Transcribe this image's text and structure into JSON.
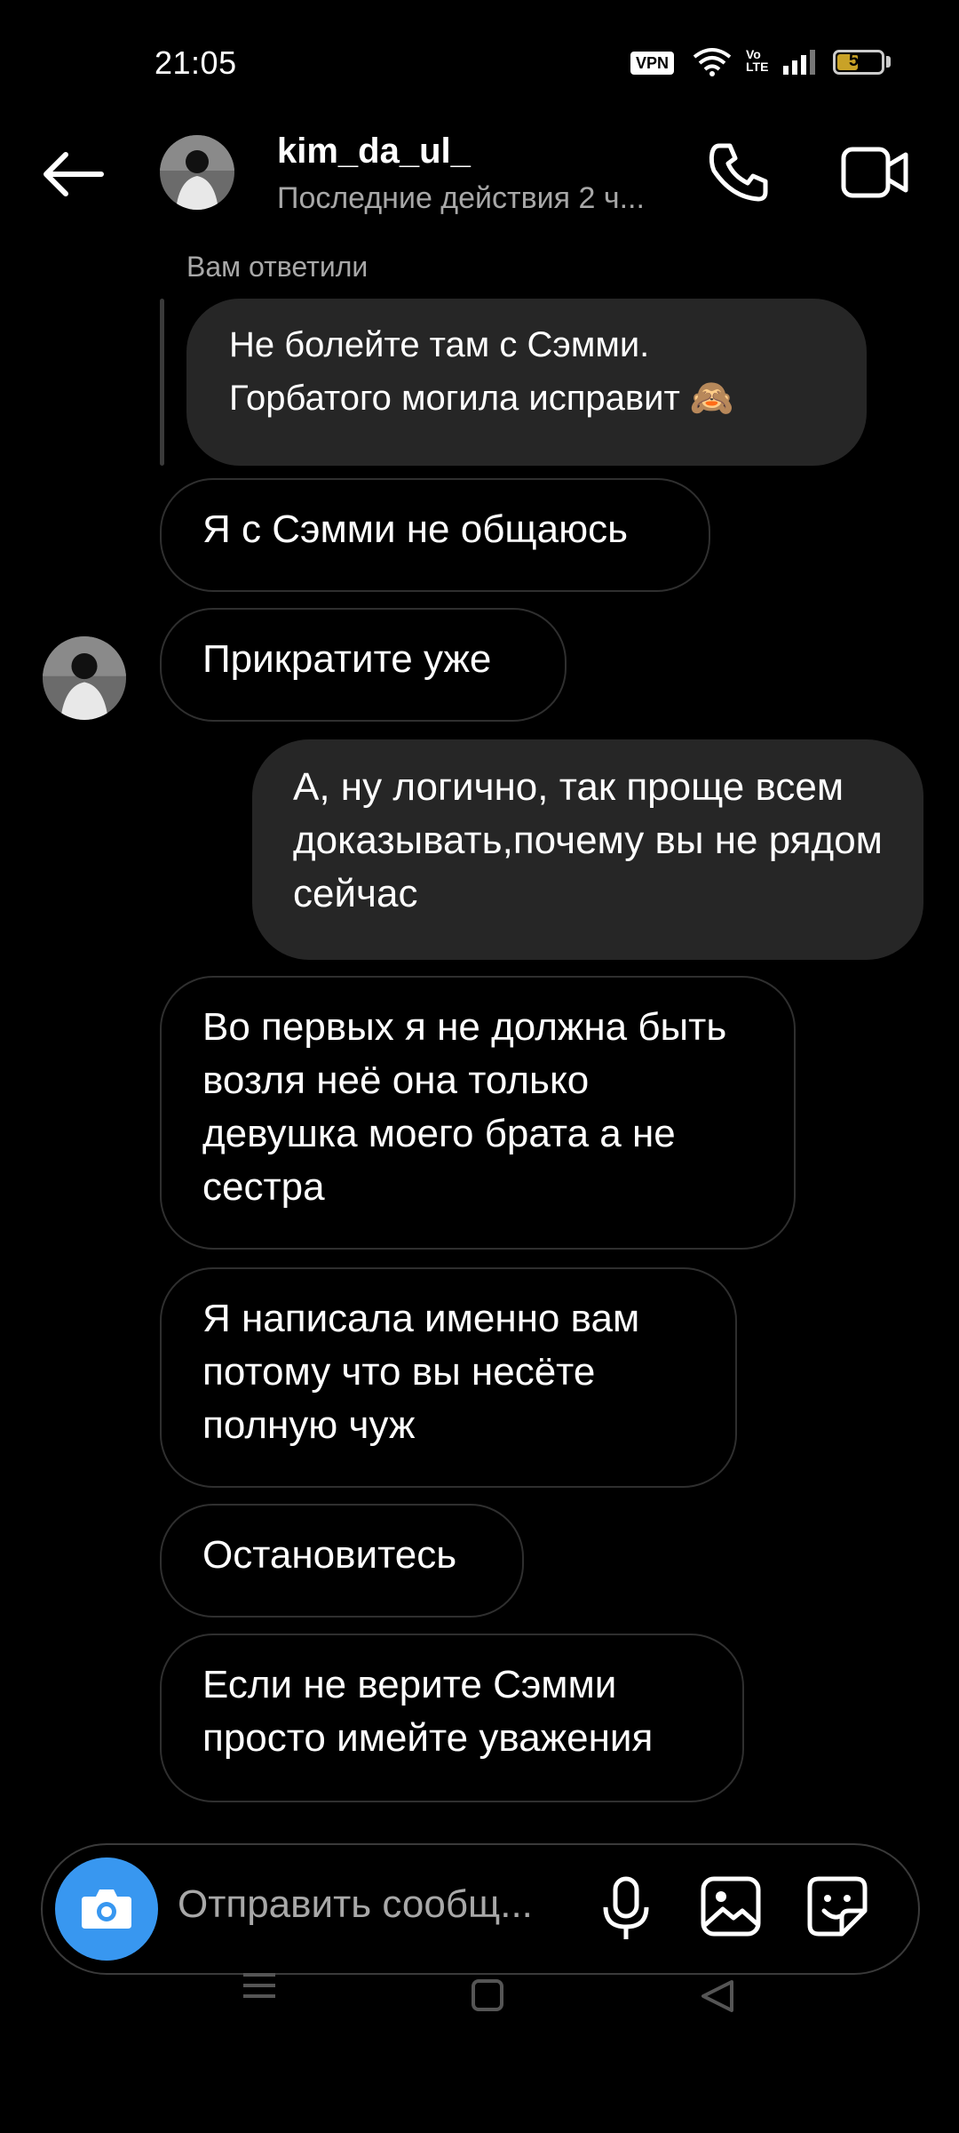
{
  "status_bar": {
    "time": "21:05",
    "vpn": "VPN",
    "volte": "Vo LTE",
    "battery": "52",
    "battery_level": 0.52
  },
  "header": {
    "username": "kim_da_ul_",
    "last_active": "Последние действия 2 ч..."
  },
  "chat": {
    "reply_label": "Вам ответили",
    "quoted_message_line1": "Не болейте там с Сэмми.",
    "quoted_message_line2": "Горбатого могила исправит 🙈",
    "messages": [
      {
        "direction": "in",
        "text": "Я с Сэмми не общаюсь"
      },
      {
        "direction": "in",
        "text": "Прикратите уже"
      },
      {
        "direction": "out",
        "text": "А, ну логично, так проще всем доказывать,почему вы не рядом сейчас"
      },
      {
        "direction": "in",
        "text": "Во первых я не должна быть возля неё она только девушка моего брата а не сестра"
      },
      {
        "direction": "in",
        "text": "Я написала именно вам потому что вы несёте полную чуж"
      },
      {
        "direction": "in",
        "text": "Остановитесь"
      },
      {
        "direction": "in",
        "text": "Если не верите Сэмми просто имейте уважения"
      }
    ]
  },
  "composer": {
    "placeholder": "Отправить сообщ..."
  },
  "colors": {
    "background": "#000000",
    "bubble_out": "#262626",
    "bubble_in_border": "#2f2f2f",
    "camera_button": "#3897f0",
    "muted_text": "#a8a8a8"
  },
  "icons": [
    "back-arrow-icon",
    "phone-icon",
    "video-call-icon",
    "camera-icon",
    "microphone-icon",
    "gallery-icon",
    "sticker-icon",
    "menu-icon",
    "home-icon",
    "back-triangle-icon"
  ]
}
